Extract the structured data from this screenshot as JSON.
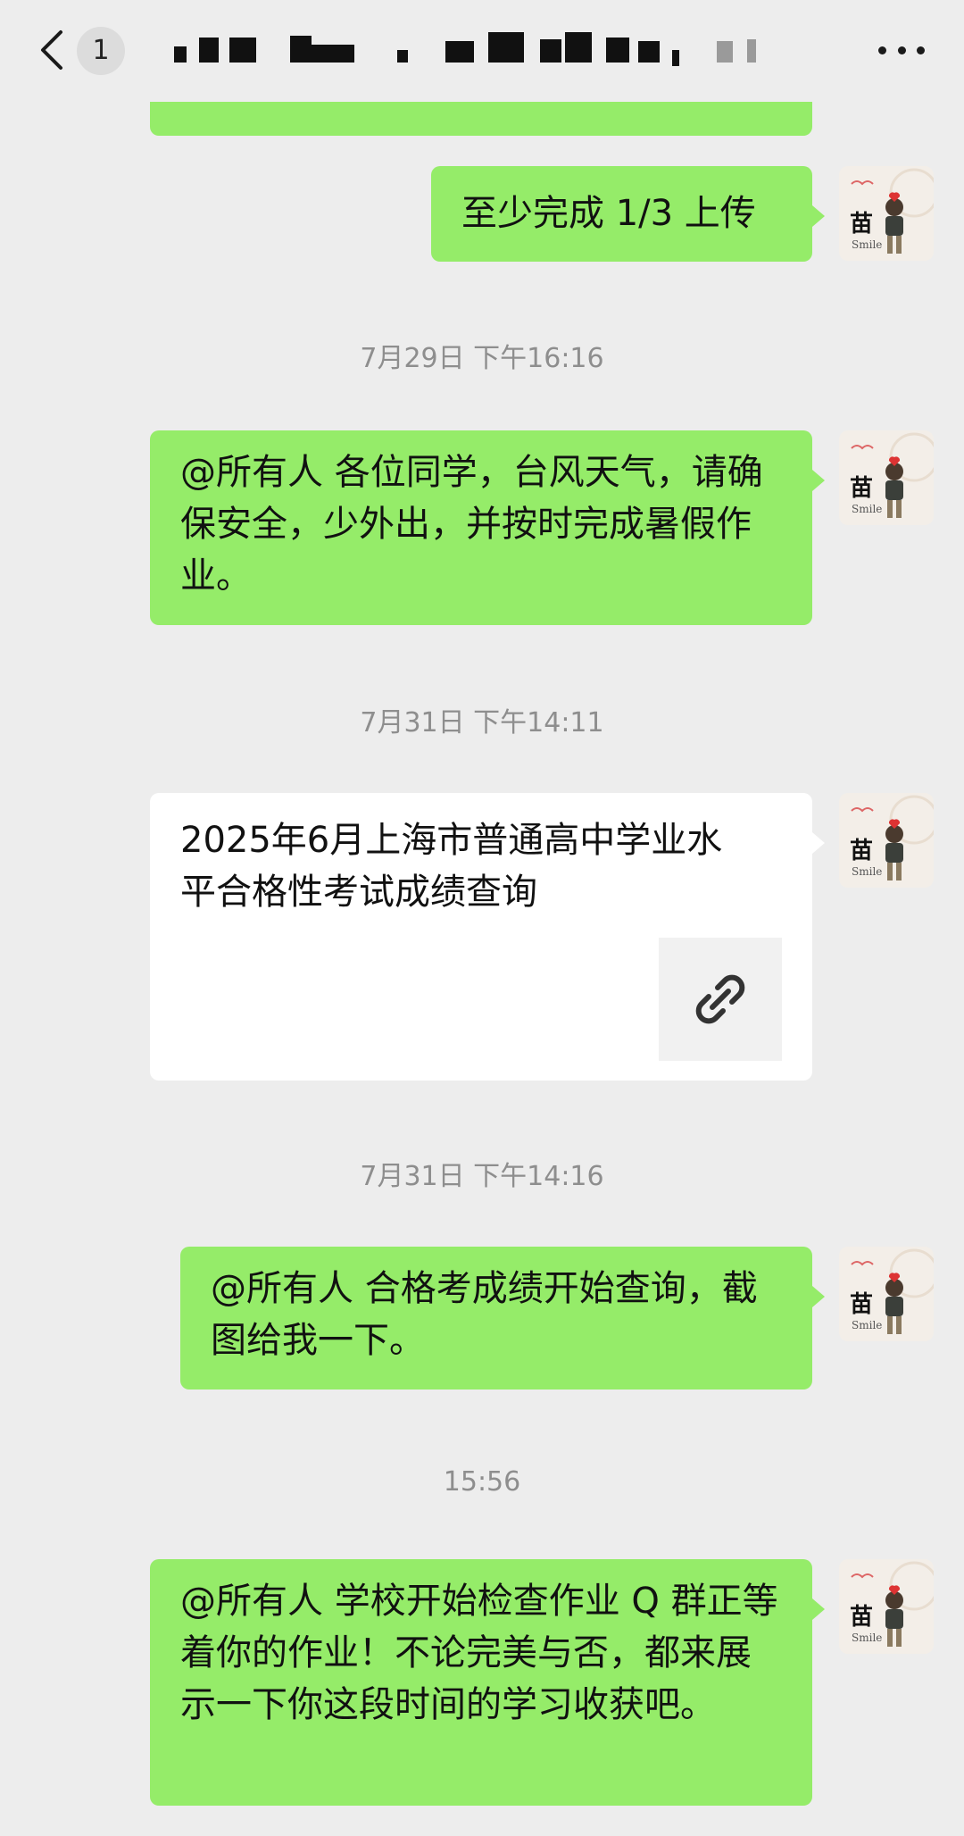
{
  "header": {
    "unread_count": "1",
    "back_icon": "chevron-left-icon",
    "more_icon": "more-dots-icon"
  },
  "messages": [
    {
      "type": "text",
      "text": ""
    },
    {
      "type": "text",
      "text": "至少完成 1/3 上传",
      "avatar_char": "苗"
    },
    {
      "type": "timestamp",
      "text": "7月29日 下午16:16"
    },
    {
      "type": "text",
      "text": "@所有人  各位同学，台风天气，请确保安全，少外出，并按时完成暑假作业。",
      "avatar_char": "苗"
    },
    {
      "type": "timestamp",
      "text": "7月31日 下午14:11"
    },
    {
      "type": "link",
      "title": "2025年6月上海市普通高中学业水平合格性考试成绩查询",
      "avatar_char": "苗",
      "icon": "link-icon"
    },
    {
      "type": "timestamp",
      "text": "7月31日 下午14:16"
    },
    {
      "type": "text",
      "text": "@所有人  合格考成绩开始查询，截图给我一下。",
      "avatar_char": "苗"
    },
    {
      "type": "timestamp",
      "text": "15:56"
    },
    {
      "type": "text",
      "text": "@所有人  学校开始检查作业 Q 群正等着你的作业！不论完美与否，都来展示一下你这段时间的学习收获吧。",
      "avatar_char": "苗"
    }
  ],
  "colors": {
    "background": "#ededed",
    "bubble_green": "#95ec69",
    "bubble_white": "#ffffff",
    "timestamp_text": "#8e8e8e"
  }
}
